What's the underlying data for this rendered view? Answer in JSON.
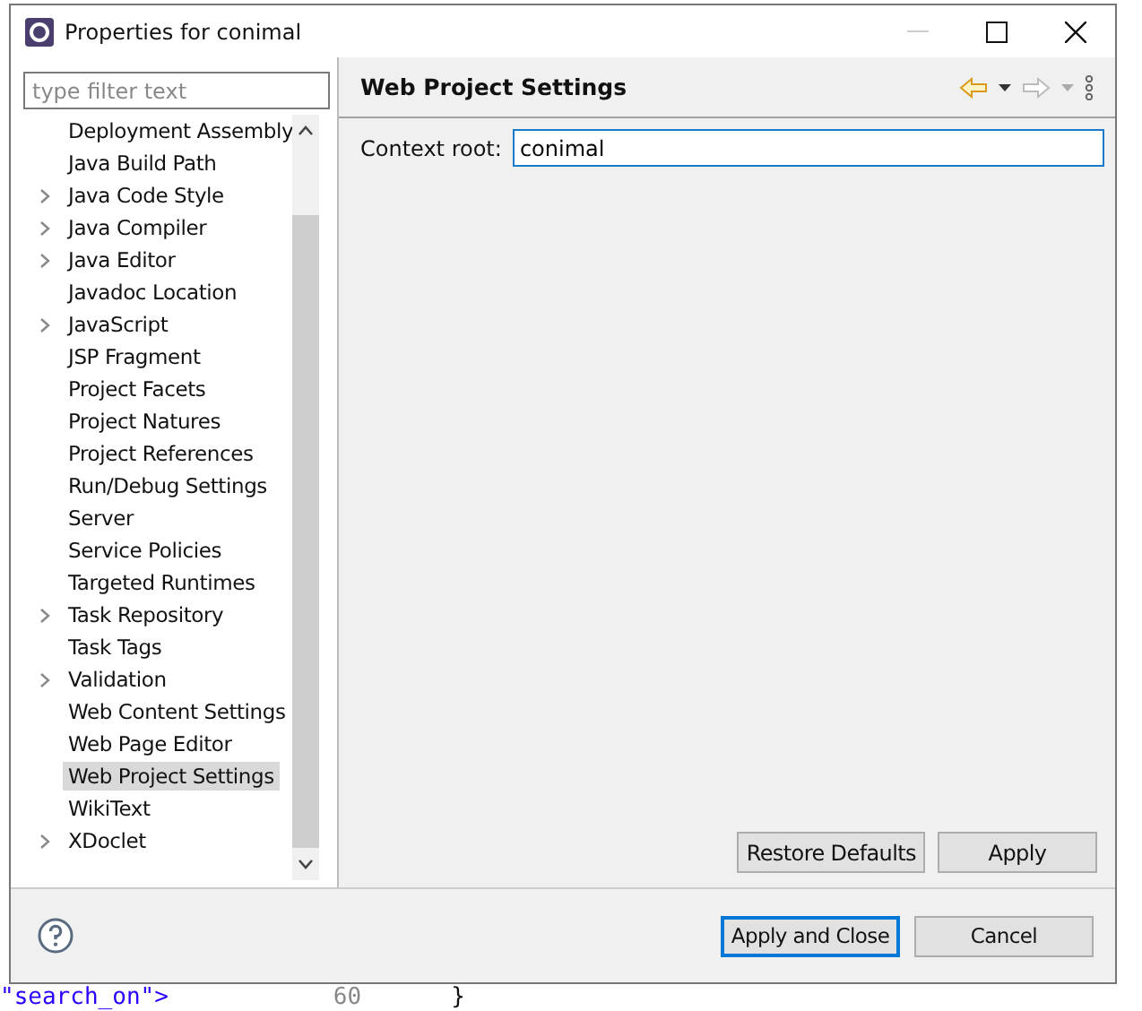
{
  "window": {
    "title": "Properties for conimal"
  },
  "filter": {
    "placeholder": "type filter text"
  },
  "tree": [
    {
      "label": "Deployment Assembly",
      "expandable": false,
      "selected": false
    },
    {
      "label": "Java Build Path",
      "expandable": false,
      "selected": false
    },
    {
      "label": "Java Code Style",
      "expandable": true,
      "selected": false
    },
    {
      "label": "Java Compiler",
      "expandable": true,
      "selected": false
    },
    {
      "label": "Java Editor",
      "expandable": true,
      "selected": false
    },
    {
      "label": "Javadoc Location",
      "expandable": false,
      "selected": false
    },
    {
      "label": "JavaScript",
      "expandable": true,
      "selected": false
    },
    {
      "label": "JSP Fragment",
      "expandable": false,
      "selected": false
    },
    {
      "label": "Project Facets",
      "expandable": false,
      "selected": false
    },
    {
      "label": "Project Natures",
      "expandable": false,
      "selected": false
    },
    {
      "label": "Project References",
      "expandable": false,
      "selected": false
    },
    {
      "label": "Run/Debug Settings",
      "expandable": false,
      "selected": false
    },
    {
      "label": "Server",
      "expandable": false,
      "selected": false
    },
    {
      "label": "Service Policies",
      "expandable": false,
      "selected": false
    },
    {
      "label": "Targeted Runtimes",
      "expandable": false,
      "selected": false
    },
    {
      "label": "Task Repository",
      "expandable": true,
      "selected": false
    },
    {
      "label": "Task Tags",
      "expandable": false,
      "selected": false
    },
    {
      "label": "Validation",
      "expandable": true,
      "selected": false
    },
    {
      "label": "Web Content Settings",
      "expandable": false,
      "selected": false
    },
    {
      "label": "Web Page Editor",
      "expandable": false,
      "selected": false
    },
    {
      "label": "Web Project Settings",
      "expandable": false,
      "selected": true
    },
    {
      "label": "WikiText",
      "expandable": false,
      "selected": false
    },
    {
      "label": "XDoclet",
      "expandable": true,
      "selected": false
    }
  ],
  "page": {
    "title": "Web Project Settings",
    "field_label": "Context root:",
    "field_value": "conimal"
  },
  "page_buttons": [
    "Restore Defaults",
    "Apply"
  ],
  "dialog_buttons": [
    {
      "label": "Apply and Close",
      "default": true
    },
    {
      "label": "Cancel",
      "default": false
    }
  ],
  "editor_behind": {
    "code": "\"search_on\">",
    "line_number": "60",
    "brace": "}"
  }
}
